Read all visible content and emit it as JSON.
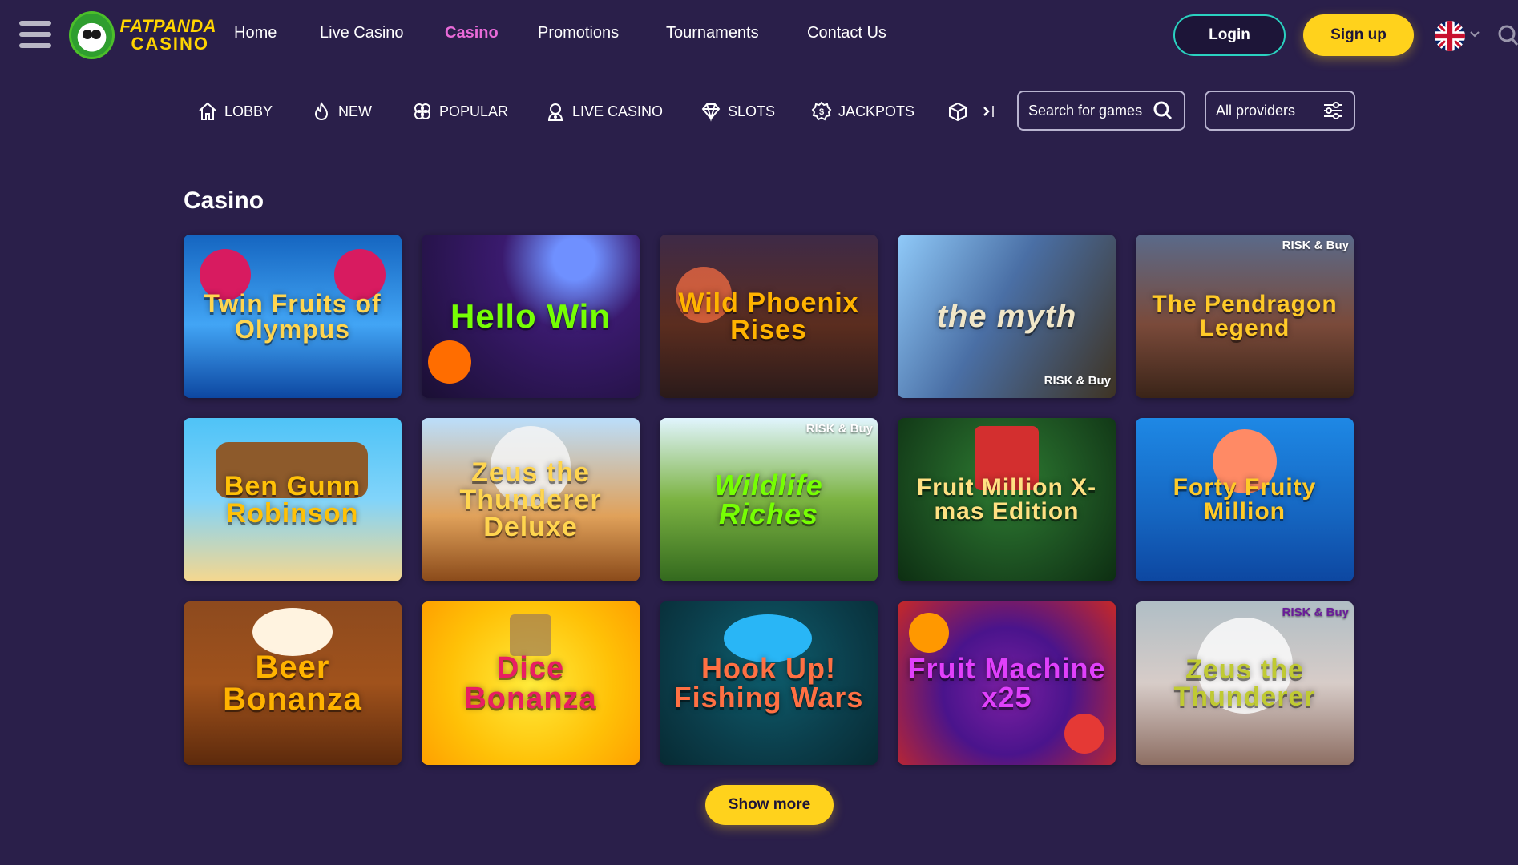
{
  "header": {
    "logo": {
      "line1": "FATPANDA",
      "line2": "CASINO"
    },
    "nav": [
      {
        "label": "Home",
        "active": false
      },
      {
        "label": "Live Casino",
        "active": false
      },
      {
        "label": "Casino",
        "active": true
      },
      {
        "label": "Promotions",
        "active": false
      },
      {
        "label": "Tournaments",
        "active": false
      },
      {
        "label": "Contact Us",
        "active": false
      }
    ],
    "login_label": "Login",
    "signup_label": "Sign up",
    "language_icon": "uk-flag-icon"
  },
  "categories": [
    {
      "label": "LOBBY",
      "icon": "home-icon"
    },
    {
      "label": "NEW",
      "icon": "flame-icon"
    },
    {
      "label": "POPULAR",
      "icon": "clover-icon"
    },
    {
      "label": "LIVE CASINO",
      "icon": "dealer-icon"
    },
    {
      "label": "SLOTS",
      "icon": "diamond-icon"
    },
    {
      "label": "JACKPOTS",
      "icon": "coin-icon"
    }
  ],
  "search": {
    "placeholder": "Search for games"
  },
  "providers": {
    "label": "All providers"
  },
  "main": {
    "section_title": "Casino",
    "games": [
      {
        "title": "Twin Fruits of Olympus",
        "badge": ""
      },
      {
        "title": "Hello Win",
        "badge": ""
      },
      {
        "title": "Wild Phoenix Rises",
        "badge": ""
      },
      {
        "title": "the myth",
        "badge": "RISK & Buy"
      },
      {
        "title": "The Pendragon Legend",
        "badge": "RISK & Buy"
      },
      {
        "title": "Ben Gunn Robinson",
        "badge": ""
      },
      {
        "title": "Zeus the Thunderer Deluxe",
        "badge": ""
      },
      {
        "title": "Wildlife Riches",
        "badge": "RISK & Buy"
      },
      {
        "title": "Fruit Million X-mas Edition",
        "badge": ""
      },
      {
        "title": "Forty Fruity Million",
        "badge": ""
      },
      {
        "title": "Beer Bonanza",
        "badge": ""
      },
      {
        "title": "Dice Bonanza",
        "badge": ""
      },
      {
        "title": "Hook Up! Fishing Wars",
        "badge": ""
      },
      {
        "title": "Fruit Machine x25",
        "badge": ""
      },
      {
        "title": "Zeus the Thunderer",
        "badge": "RISK & Buy"
      }
    ],
    "show_more_label": "Show more"
  },
  "colors": {
    "background": "#2a1f4a",
    "accent_pink": "#e86ad8",
    "accent_yellow": "#ffd21c",
    "login_border": "#2ad1c0"
  }
}
